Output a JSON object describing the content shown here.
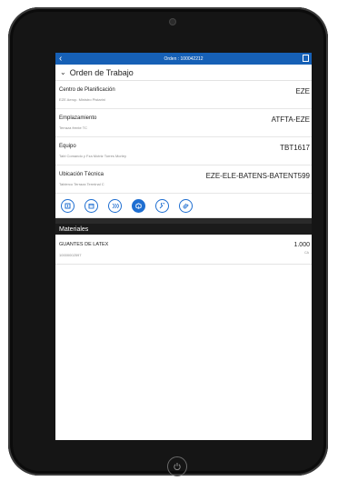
{
  "header": {
    "title": "Orden : 100042212",
    "back_icon": "chevron-left-icon",
    "right_icon": "document-icon",
    "accent": "#1660b6"
  },
  "section": {
    "title": "Orden de Trabajo"
  },
  "fields": [
    {
      "label": "Centro de Planificación",
      "sub": "EZE Aerop. Ministro Pistarini",
      "value": "EZE"
    },
    {
      "label": "Emplazamiento",
      "sub": "Terraza frente TC",
      "value": "ATFTA-EZE"
    },
    {
      "label": "Equipo",
      "sub": "Tabl Comando y Fza Motriz Torres Morley",
      "value": "TBT1617"
    },
    {
      "label": "Ubicación Técnica",
      "sub": "Tablerco Terraza Terminal C",
      "value": "EZE-ELE-BATENS-BATENT599"
    }
  ],
  "actions": [
    {
      "icon": "square-icon"
    },
    {
      "icon": "calendar-icon"
    },
    {
      "icon": "steps-icon"
    },
    {
      "icon": "box-icon"
    },
    {
      "icon": "wrench-icon"
    },
    {
      "icon": "paperclip-icon"
    }
  ],
  "materials": {
    "title": "Materiales",
    "items": [
      {
        "name": "GUANTES DE LATEX",
        "code": "10000002597",
        "qty": "1.000",
        "unit": "CA"
      }
    ]
  }
}
